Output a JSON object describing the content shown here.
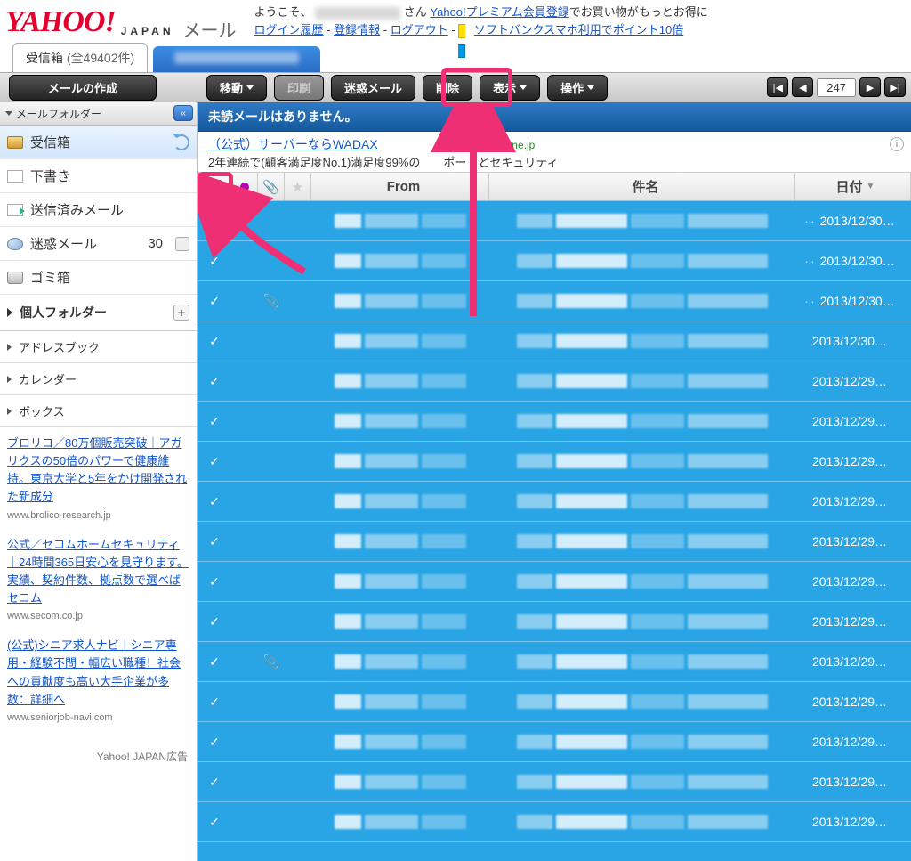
{
  "header": {
    "brand_yahoo": "YAHOO",
    "brand_bang": "!",
    "brand_japan": "JAPAN",
    "brand_mail": "メール",
    "welcome_prefix": "ようこそ、",
    "welcome_suffix": " さん ",
    "premium_link": "Yahoo!プレミアム会員登録",
    "premium_suffix": "でお買い物がもっとお得に",
    "login_history": "ログイン履歴",
    "reg_info": "登録情報",
    "logout": "ログアウト",
    "softbank": "ソフトバンクスマホ利用でポイント10倍",
    "sep": " - "
  },
  "tabs": {
    "inbox_label": "受信箱",
    "inbox_count_text": " (全49402件)"
  },
  "toolbar": {
    "compose": "メールの作成",
    "move": "移動",
    "print": "印刷",
    "spam": "迷惑メール",
    "delete": "削除",
    "view": "表示",
    "action": "操作",
    "page": "247"
  },
  "sidebar": {
    "folders_title": "メールフォルダー",
    "inbox": "受信箱",
    "drafts": "下書き",
    "sent": "送信済みメール",
    "spam": "迷惑メール",
    "spam_count": "30",
    "trash": "ゴミ箱",
    "personal": "個人フォルダー",
    "addressbook": "アドレスブック",
    "calendar": "カレンダー",
    "box": "ボックス",
    "ads_footer": "Yahoo! JAPAN広告",
    "ads": [
      {
        "text": "ブロリコ／80万個販売突破｜アガリクスの50倍のパワーで健康維持。東京大学と5年をかけ開発された新成分",
        "url": "www.brolico-research.jp"
      },
      {
        "text": "公式／セコムホームセキュリティ｜24時間365日安心を見守ります。実績、契約件数、拠点数で選べばセコム",
        "url": "www.secom.co.jp"
      },
      {
        "text": "(公式)シニア求人ナビ｜シニア専用・経験不問・幅広い職種！社会への貢献度も高い大手企業が多数：詳細へ",
        "url": "www.seniorjob-navi.com"
      }
    ]
  },
  "content": {
    "info_bar": "未読メールはありません。",
    "ad_title": "（公式）サーバーならWADAX",
    "ad_url": "www.wadax.ne.jp",
    "ad_desc_a": "2年連続で(顧客満足度No.1)満足度99%の",
    "ad_desc_b": "ポートとセキュリティ",
    "col_from": "From",
    "col_subject": "件名",
    "col_date": "日付",
    "rows": [
      {
        "att": false,
        "date": "2013/12/30…",
        "dots": true
      },
      {
        "att": false,
        "date": "2013/12/30…",
        "dots": true
      },
      {
        "att": true,
        "date": "2013/12/30…",
        "dots": true
      },
      {
        "att": false,
        "date": "2013/12/30…",
        "dots": false
      },
      {
        "att": false,
        "date": "2013/12/29…",
        "dots": false
      },
      {
        "att": false,
        "date": "2013/12/29…",
        "dots": false
      },
      {
        "att": false,
        "date": "2013/12/29…",
        "dots": false
      },
      {
        "att": false,
        "date": "2013/12/29…",
        "dots": false
      },
      {
        "att": false,
        "date": "2013/12/29…",
        "dots": false
      },
      {
        "att": false,
        "date": "2013/12/29…",
        "dots": false
      },
      {
        "att": false,
        "date": "2013/12/29…",
        "dots": false
      },
      {
        "att": true,
        "date": "2013/12/29…",
        "dots": false
      },
      {
        "att": false,
        "date": "2013/12/29…",
        "dots": false
      },
      {
        "att": false,
        "date": "2013/12/29…",
        "dots": false
      },
      {
        "att": false,
        "date": "2013/12/29…",
        "dots": false
      },
      {
        "att": false,
        "date": "2013/12/29…",
        "dots": false
      }
    ]
  }
}
